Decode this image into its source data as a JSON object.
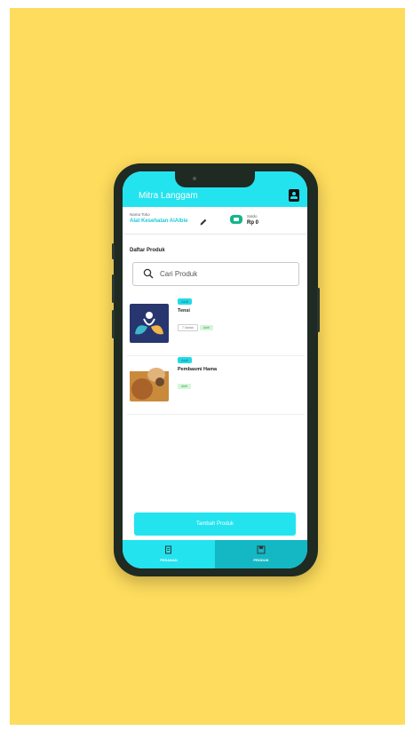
{
  "colors": {
    "background": "#fedc5d",
    "accent": "#23e3ef",
    "accent_dark": "#13b8c4",
    "saldo_icon": "#14b58a"
  },
  "appbar": {
    "title": "Mitra Langgam",
    "profile_icon": "account-box-icon"
  },
  "store": {
    "label": "Nama Toko",
    "name": "Alat Kesehatan AlAlbie",
    "edit_icon": "pencil-icon",
    "saldo_icon": "wallet-icon",
    "saldo_label": "Saldo",
    "saldo_value": "Rp 0"
  },
  "products_section": {
    "title": "Daftar Produk",
    "search": {
      "placeholder": "Cari Produk",
      "value": "",
      "icon": "search-icon"
    }
  },
  "products": [
    {
      "badge": "Aktif",
      "name": "Tensi",
      "chips": [
        "7 Varian",
        "Aktif"
      ]
    },
    {
      "badge": "Aktif",
      "name": "Pembasmi Hama",
      "chips": [
        "Aktif"
      ]
    }
  ],
  "cta": {
    "label": "Tambah Produk"
  },
  "bottom_nav": {
    "items": [
      {
        "label": "PESANAN",
        "icon": "order-icon",
        "active": false
      },
      {
        "label": "PRODUK",
        "icon": "product-icon",
        "active": true
      }
    ]
  }
}
